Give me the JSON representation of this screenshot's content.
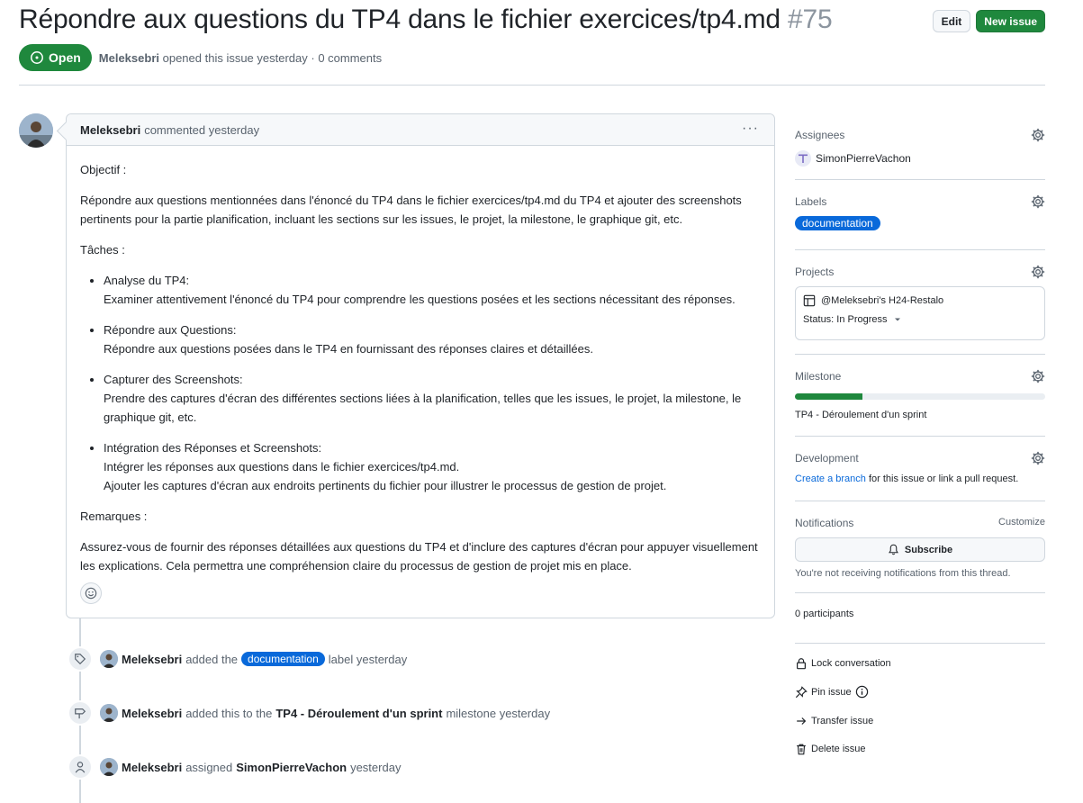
{
  "issue": {
    "title": "Répondre aux questions du TP4 dans le fichier exercices/tp4.md",
    "number": "#75",
    "state": "Open",
    "author": "Meleksebri",
    "opened_text": "opened this issue yesterday · 0 comments"
  },
  "header_buttons": {
    "edit": "Edit",
    "new_issue": "New issue"
  },
  "comment": {
    "author": "Meleksebri",
    "meta": "commented yesterday",
    "menu": "···",
    "objectif_label": "Objectif :",
    "objectif_text": "Répondre aux questions mentionnées dans l'énoncé du TP4 dans le fichier exercices/tp4.md du TP4 et ajouter des screenshots pertinents pour la partie planification, incluant les sections sur les issues, le projet, la milestone, le graphique git, etc.",
    "taches_label": "Tâches :",
    "tasks": [
      {
        "title": "Analyse du TP4:",
        "lines": [
          "Examiner attentivement l'énoncé du TP4 pour comprendre les questions posées et les sections nécessitant des réponses."
        ]
      },
      {
        "title": "Répondre aux Questions:",
        "lines": [
          "Répondre aux questions posées dans le TP4 en fournissant des réponses claires et détaillées."
        ]
      },
      {
        "title": "Capturer des Screenshots:",
        "lines": [
          "Prendre des captures d'écran des différentes sections liées à la planification, telles que les issues, le projet, la milestone, le graphique git, etc."
        ]
      },
      {
        "title": "Intégration des Réponses et Screenshots:",
        "lines": [
          "Intégrer les réponses aux questions dans le fichier exercices/tp4.md.",
          "Ajouter les captures d'écran aux endroits pertinents du fichier pour illustrer le processus de gestion de projet."
        ]
      }
    ],
    "remarques_label": "Remarques :",
    "remarques_text": "Assurez-vous de fournir des réponses détaillées aux questions du TP4 et d'inclure des captures d'écran pour appuyer visuellement les explications. Cela permettra une compréhension claire du processus de gestion de projet mis en place."
  },
  "events": [
    {
      "actor": "Meleksebri",
      "pre": "added the",
      "label": "documentation",
      "post": "label yesterday"
    },
    {
      "actor": "Meleksebri",
      "pre": "added this to the",
      "milestone": "TP4 - Déroulement d'un sprint",
      "post": "milestone yesterday"
    },
    {
      "actor": "Meleksebri",
      "pre": "assigned",
      "assignee": "SimonPierreVachon",
      "post": "yesterday"
    }
  ],
  "sidebar": {
    "assignees_title": "Assignees",
    "assignee": "SimonPierreVachon",
    "labels_title": "Labels",
    "label": "documentation",
    "projects_title": "Projects",
    "project_name": "@Meleksebri's H24-Restalo",
    "project_status": "Status: In Progress",
    "milestone_title": "Milestone",
    "milestone_progress": 0.27,
    "milestone_name": "TP4 - Déroulement d'un sprint",
    "development_title": "Development",
    "dev_link": "Create a branch",
    "dev_rest": " for this issue or link a pull request.",
    "notifications_title": "Notifications",
    "customize": "Customize",
    "subscribe": "Subscribe",
    "notif_note": "You're not receiving notifications from this thread.",
    "participants": "0 participants",
    "actions": {
      "lock": "Lock conversation",
      "pin": "Pin issue",
      "transfer": "Transfer issue",
      "delete": "Delete issue"
    }
  },
  "colors": {
    "green": "#1f883d",
    "blue": "#0969da",
    "muted": "#59636e",
    "border": "#d0d7de"
  }
}
